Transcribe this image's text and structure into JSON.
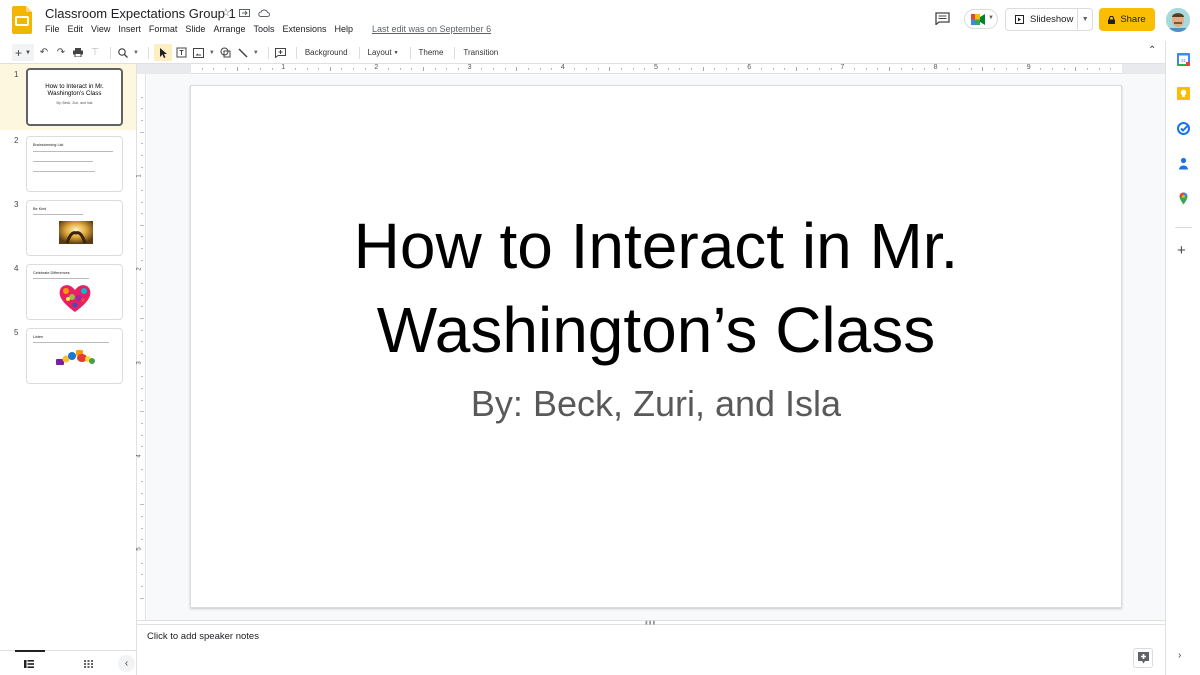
{
  "app": {
    "doc_title": "Classroom Expectations Group 1",
    "last_edit": "Last edit was on September 6",
    "menu": [
      "File",
      "Edit",
      "View",
      "Insert",
      "Format",
      "Slide",
      "Arrange",
      "Tools",
      "Extensions",
      "Help"
    ],
    "slideshow_label": "Slideshow",
    "share_label": "Share",
    "brand_color": "#fbbc04"
  },
  "toolbar": {
    "background_label": "Background",
    "layout_label": "Layout",
    "theme_label": "Theme",
    "transition_label": "Transition"
  },
  "ruler": {
    "horizontal": [
      "1",
      "2",
      "3",
      "4",
      "5",
      "6",
      "7",
      "8",
      "9"
    ],
    "vertical": [
      "1",
      "2",
      "3",
      "4",
      "5"
    ]
  },
  "filmstrip": {
    "slides": [
      {
        "num": "1",
        "title": "How to Interact in Mr. Washington's Class",
        "subtitle": "By: Beck, Zuri, and Isla"
      },
      {
        "num": "2",
        "heading": "Brainstorming List"
      },
      {
        "num": "3",
        "heading": "Be Kind"
      },
      {
        "num": "4",
        "heading": "Celebrate Differences"
      },
      {
        "num": "5",
        "heading": "Listen"
      }
    ]
  },
  "slide": {
    "title": "How to Interact in Mr. Washington’s Class",
    "subtitle": "By: Beck, Zuri, and Isla"
  },
  "notes": {
    "placeholder": "Click to add speaker notes"
  }
}
